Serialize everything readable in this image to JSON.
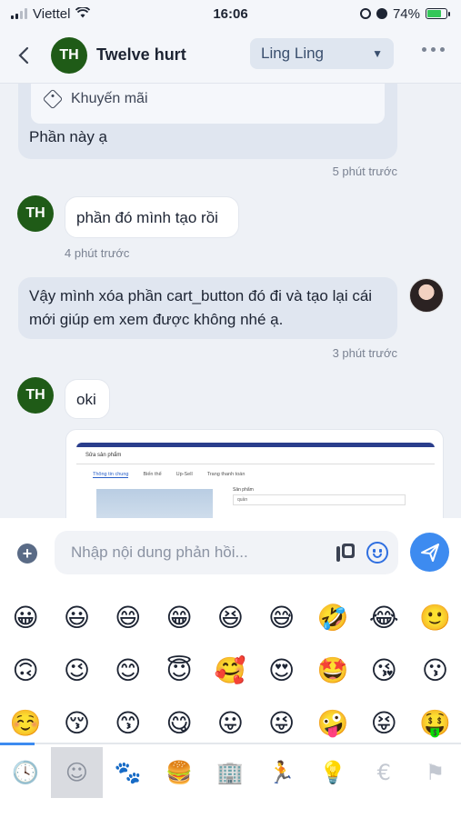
{
  "status_bar": {
    "carrier": "Viettel",
    "time": "16:06",
    "battery": "74%",
    "battery_level": 0.74
  },
  "header": {
    "back_icon": "chevron-left-icon",
    "avatar_initials": "TH",
    "title": "Twelve hurt",
    "agent_select": "Ling Ling",
    "more_icon": "more-horizontal-icon"
  },
  "messages": {
    "m1": {
      "card_label": "Khuyến mãi",
      "text": "Phần này ạ",
      "time": "5 phút trước"
    },
    "m2": {
      "avatar_initials": "TH",
      "text": "phần đó mình tạo rồi",
      "time": "4 phút trước"
    },
    "m3": {
      "text": "Vậy mình xóa phần cart_button đó đi và tạo lại cái mới giúp em xem được không nhé ạ.",
      "time": "3 phút trước"
    },
    "m4": {
      "avatar_initials": "TH",
      "text": "oki"
    },
    "m5": {
      "shot_title": "Sửa sản phẩm",
      "shot_tabs": [
        "Thông tin chung",
        "Biến thể",
        "Up-Sell",
        "Trang thanh toán"
      ],
      "shot_field_label": "Sản phẩm",
      "shot_field_value": "quần"
    }
  },
  "composer": {
    "placeholder": "Nhập nội dung phản hồi...",
    "add_icon": "plus-circle-icon",
    "library_icon": "library-icon",
    "emoji_icon": "smiley-icon",
    "send_icon": "send-icon"
  },
  "emoji_keyboard": {
    "emojis": [
      "😀",
      "😃",
      "😄",
      "😁",
      "😆",
      "😅",
      "🤣",
      "😂",
      "🙂",
      "🙃",
      "😉",
      "😊",
      "😇",
      "🥰",
      "😍",
      "🤩",
      "😘",
      "😗",
      "☺️",
      "😚",
      "😙",
      "😋",
      "😛",
      "😜",
      "🤪",
      "😝",
      "🤑"
    ],
    "categories": [
      "🕓",
      "☺",
      "🐾",
      "🍔",
      "🏢",
      "🏃",
      "💡",
      "€",
      "⚑"
    ]
  }
}
